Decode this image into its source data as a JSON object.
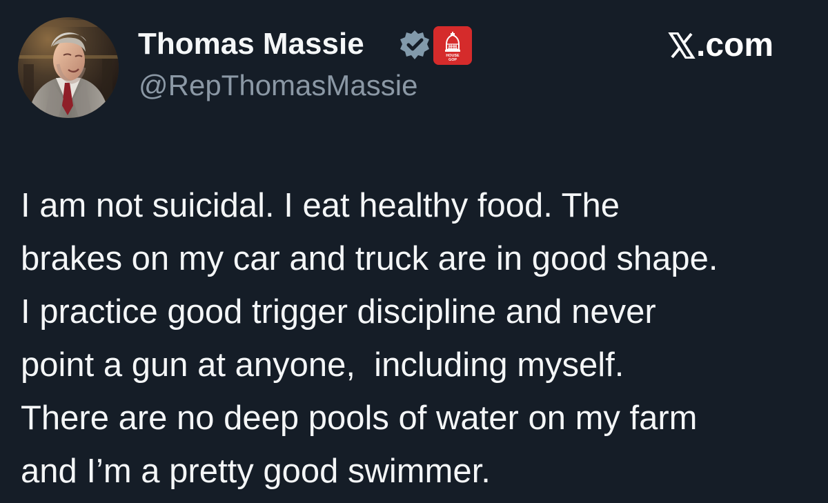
{
  "author": {
    "display_name": "Thomas Massie",
    "handle": "@RepThomasMassie",
    "avatar_icon": "person-avatar",
    "verified_icon": "verified-badge-icon",
    "affiliation_icon": "house-gop-capitol-icon",
    "affiliation_text": [
      "HOUSE",
      "GOP"
    ]
  },
  "site": {
    "logo_icon": "x-logo-icon",
    "label": ".com"
  },
  "tweet": {
    "lines": [
      "I am not suicidal. I eat healthy food. The",
      "brakes on my car and truck are in good shape.",
      "I practice good trigger discipline and never",
      "point a gun at anyone,  including myself.",
      "There are no deep pools of water on my farm",
      "and I’m a pretty good swimmer."
    ]
  },
  "colors": {
    "background": "#151d27",
    "text": "#f5f7f8",
    "handle": "#8b98a5",
    "verified": "#829aab",
    "badge_red": "#d52b2b"
  }
}
